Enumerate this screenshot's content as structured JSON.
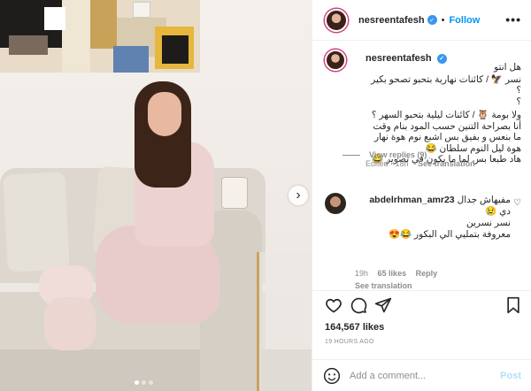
{
  "header": {
    "username": "nesreentafesh",
    "follow_label": "Follow",
    "more_icon": "•••"
  },
  "caption": {
    "username": "nesreentafesh",
    "lines": [
      "هل انتو",
      "نسر 🦅 / كائنات نهارية بتحبو تصحو بكير ؟",
      "ولا بومة 🦉 / كائنات ليلية بتحبو السهر ؟",
      "أنا بصراحة التنين حسب المود بنام وقت ما بنعس و بفيق بس اشبع نوم هوة نهار هوة ليل النوم سلطان 😂",
      "هاد طبعا بس لما ما يكون في تصوير 😂"
    ],
    "edited": "Edited",
    "age": "18h",
    "see_translation": "See translation"
  },
  "reply": {
    "username": "abdelrhman_amr23",
    "lines": [
      "مفيهاش جدال",
      "دي 😢",
      "نسر نسرين",
      "معروفة بتمليي الي البكور 😂😍"
    ],
    "age": "19h",
    "likes": "65 likes",
    "reply_label": "Reply",
    "see_translation": "See translation",
    "view_replies": "View replies (9)"
  },
  "stats": {
    "likes": "164,567 likes",
    "time": "19 HOURS AGO"
  },
  "composer": {
    "placeholder": "Add a comment...",
    "post_label": "Post"
  },
  "colors": {
    "accent": "#0095f6",
    "verified": "#3897f0",
    "muted": "#8e8e8e"
  }
}
